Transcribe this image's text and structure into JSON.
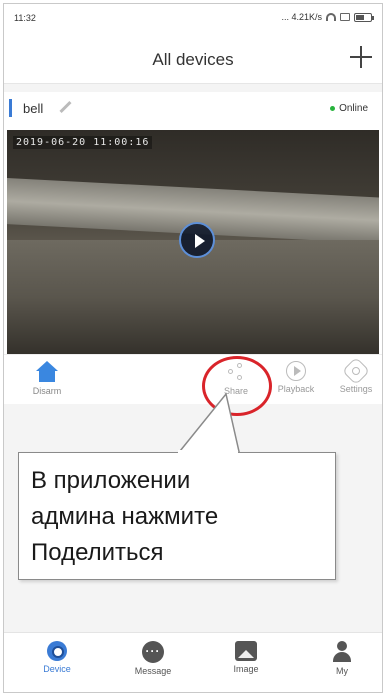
{
  "status_bar": {
    "time": "11:32",
    "network_speed": "... 4.21K/s",
    "icons": [
      "wifi-icon",
      "sim-icon",
      "battery-icon"
    ]
  },
  "header": {
    "title": "All devices",
    "add_icon": "plus-icon"
  },
  "device": {
    "name": "bell",
    "status": "Online",
    "status_color": "#27b33c",
    "video_timestamp": "2019-06-20  11:00:16"
  },
  "actions": [
    {
      "label": "Disarm",
      "icon": "house-shield-icon"
    },
    {
      "label": "Share",
      "icon": "share-icon"
    },
    {
      "label": "Playback",
      "icon": "playback-icon"
    },
    {
      "label": "Settings",
      "icon": "gear-icon"
    }
  ],
  "callout": {
    "line1": "В приложении",
    "line2": "админа нажмите",
    "line3": "Поделиться"
  },
  "highlight_color": "#d9242a",
  "bottom_nav": [
    {
      "label": "Device",
      "icon": "camera-icon",
      "active": true
    },
    {
      "label": "Message",
      "icon": "chat-icon",
      "active": false
    },
    {
      "label": "Image",
      "icon": "image-icon",
      "active": false
    },
    {
      "label": "My",
      "icon": "user-icon",
      "active": false
    }
  ],
  "accent_color": "#3a7bd5"
}
